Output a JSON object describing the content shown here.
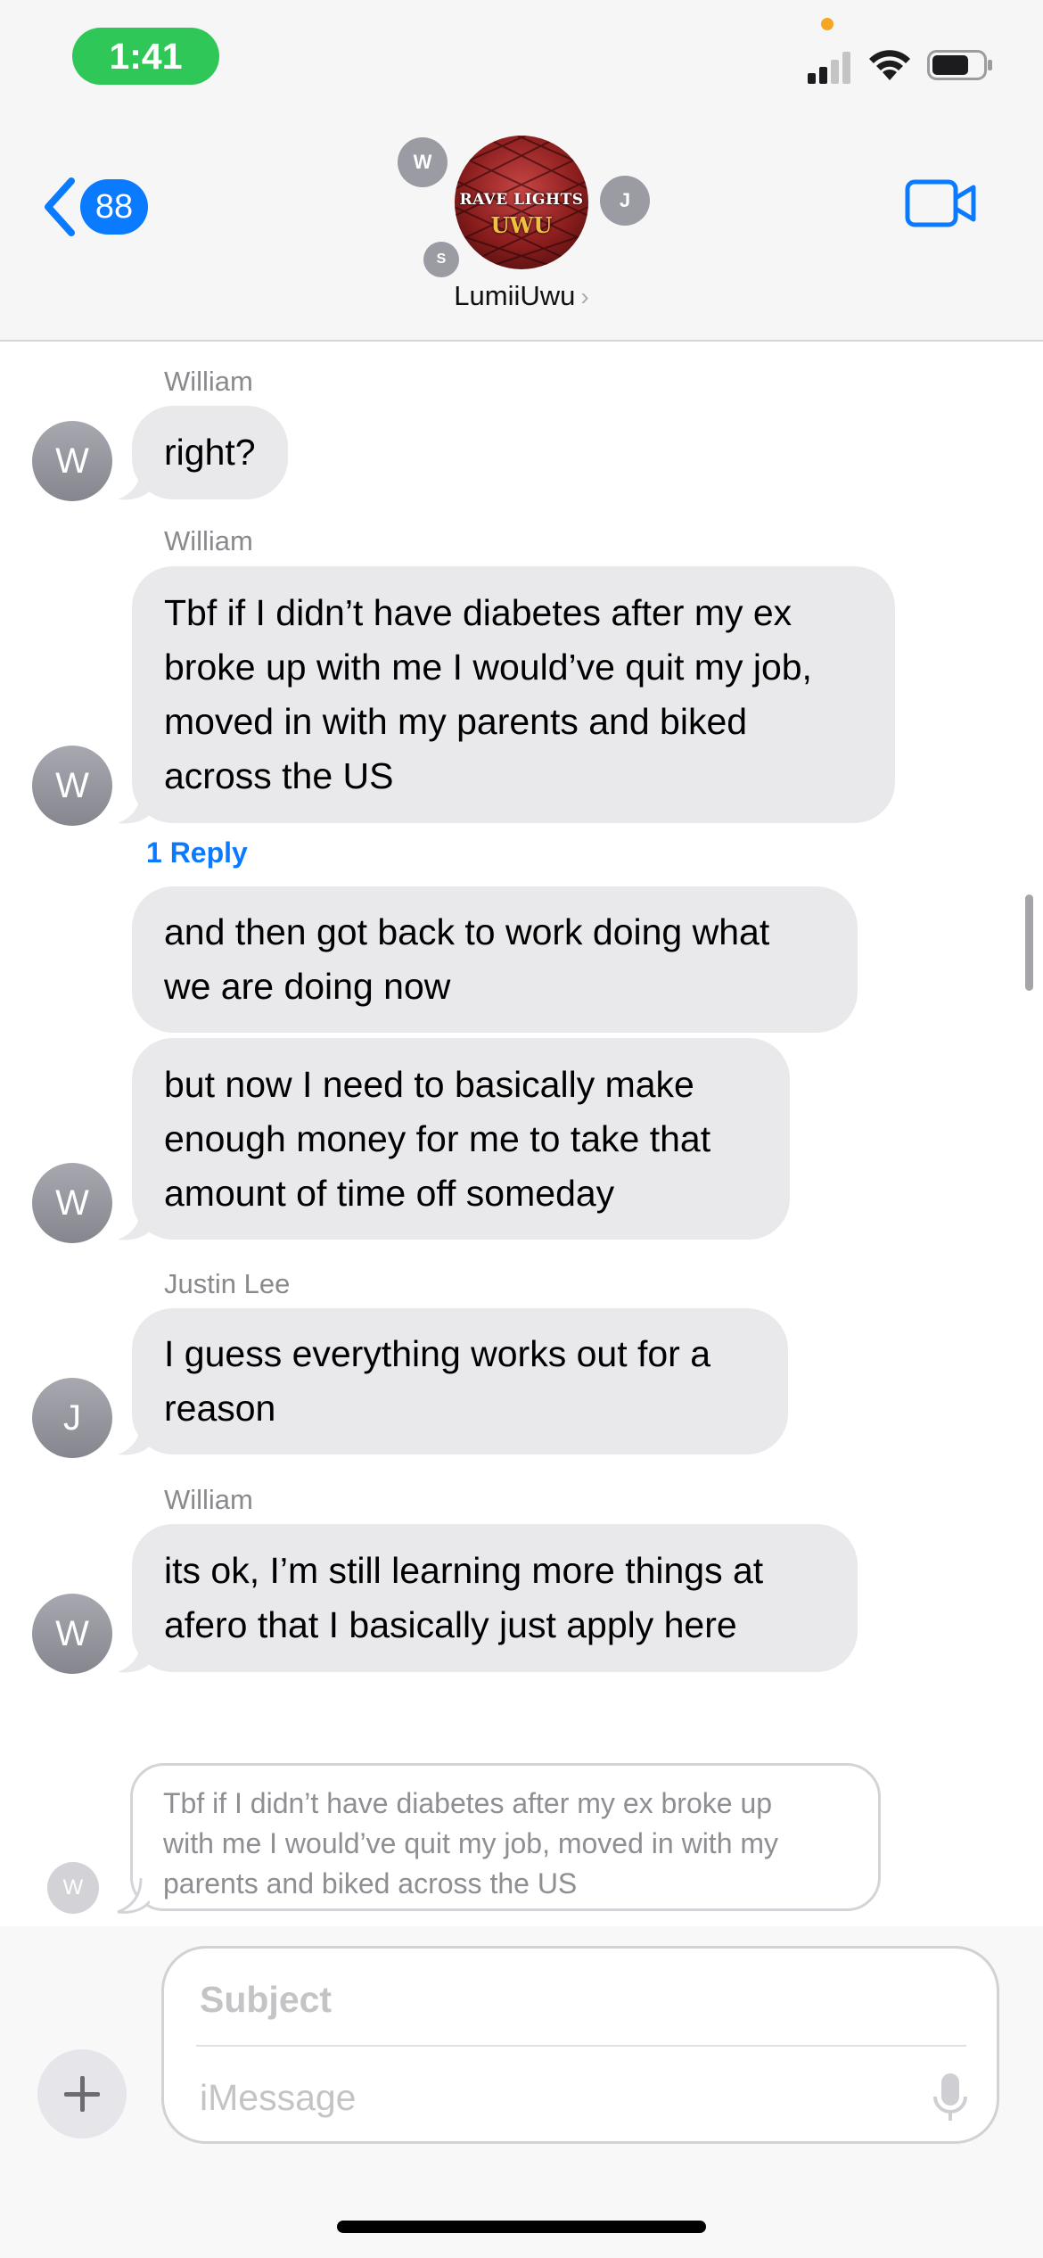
{
  "status_bar": {
    "time": "1:41",
    "colors": {
      "time_pill": "#30c759",
      "privacy_dot": "#f5a623"
    }
  },
  "header": {
    "back_count": "88",
    "group_name": "LumiiUwu",
    "group_avatar_text_top": "RAVE LIGHTS",
    "group_avatar_text_bottom": "UWU",
    "member_initials": [
      "W",
      "J",
      "S"
    ],
    "accent_color": "#0a7aff"
  },
  "messages": [
    {
      "sender": "William",
      "text": "right?",
      "avatar": "W"
    },
    {
      "sender": "William",
      "text": "Tbf if I didn’t have diabetes after my ex\nbroke up with me I would’ve quit my job,\nmoved in with my parents and biked\nacross the US",
      "avatar": "W",
      "reply_label": "1 Reply"
    },
    {
      "sender": "",
      "text": "and then got back to work doing what\nwe are doing now",
      "avatar": ""
    },
    {
      "sender": "",
      "text": "but now I need to basically make\nenough money for me to take that\namount of time off someday",
      "avatar": "W"
    },
    {
      "sender": "Justin Lee",
      "text": "I guess everything works out for a\nreason",
      "avatar": "J"
    },
    {
      "sender": "William",
      "text": "its ok,  I’m still learning more things at\nafero that I basically just apply here",
      "avatar": "W"
    }
  ],
  "quote_preview": {
    "text": "Tbf if I didn’t have diabetes after my ex broke up\nwith me I would’ve quit my job, moved in with my\nparents and biked across the US",
    "avatar": "W"
  },
  "compose": {
    "subject_placeholder": "Subject",
    "message_placeholder": "iMessage"
  },
  "icons": [
    "back-chevron-icon",
    "video-camera-icon",
    "plus-icon",
    "microphone-icon",
    "signal-icon",
    "wifi-icon",
    "battery-icon"
  ]
}
